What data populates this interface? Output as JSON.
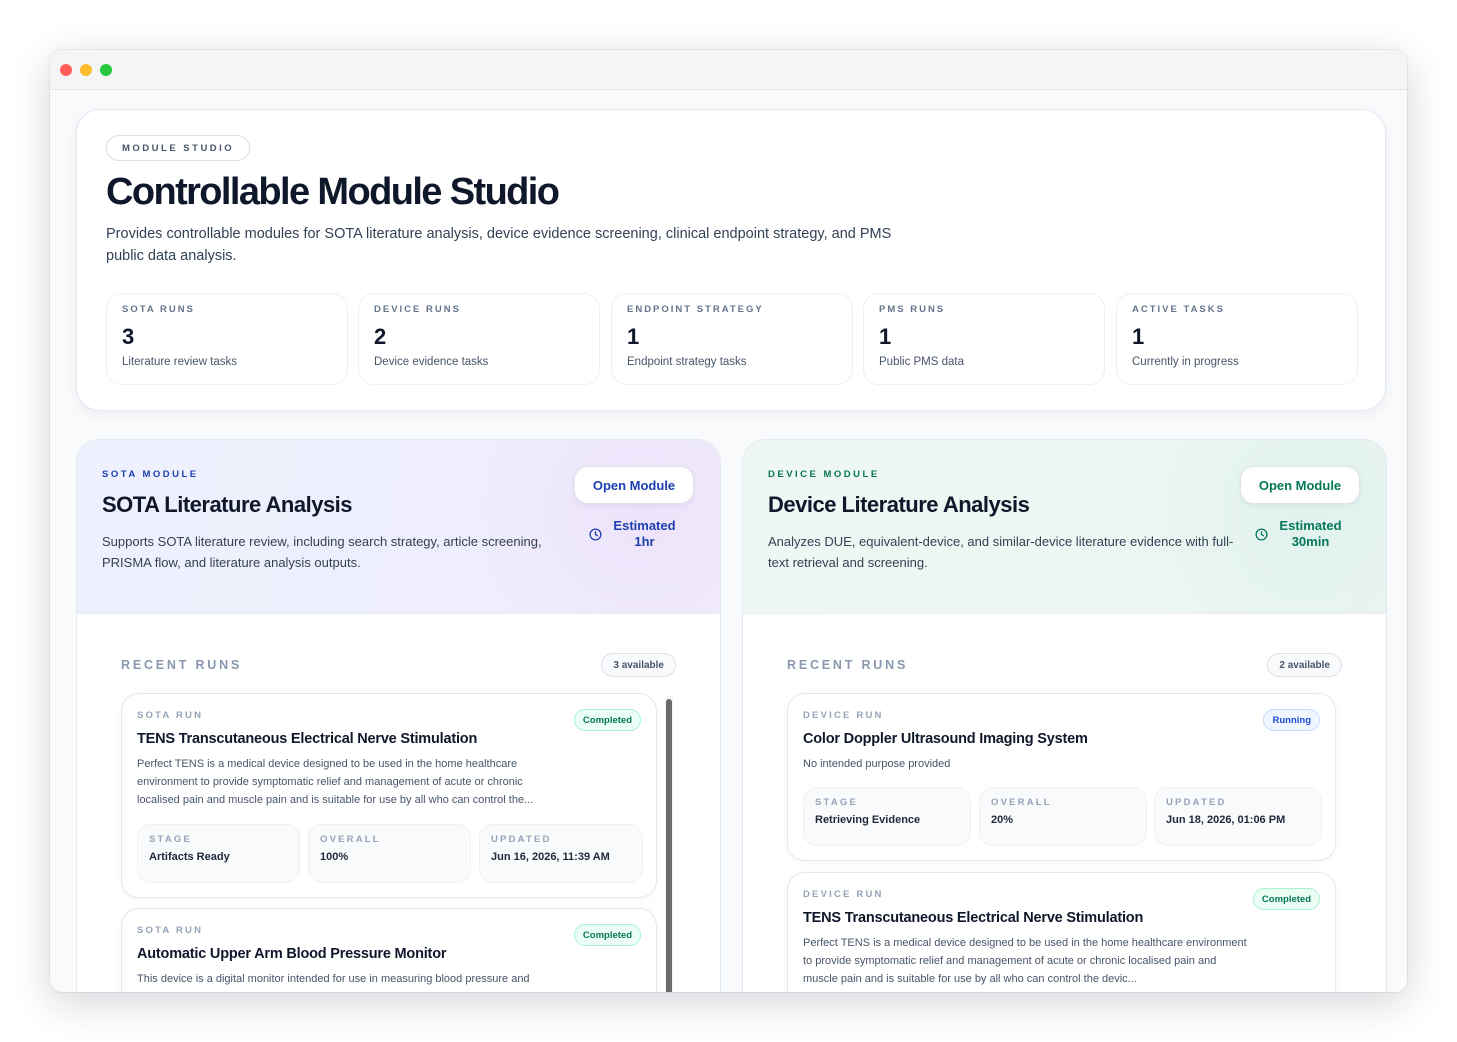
{
  "window": {
    "traffic_lights": [
      "#ff5f57",
      "#febc2e",
      "#28c840"
    ]
  },
  "hero": {
    "eyebrow": "MODULE STUDIO",
    "title": "Controllable Module Studio",
    "description": "Provides controllable modules for SOTA literature analysis, device evidence screening, clinical endpoint strategy, and PMS public data analysis.",
    "stats": [
      {
        "label": "SOTA RUNS",
        "value": "3",
        "sub": "Literature review tasks"
      },
      {
        "label": "DEVICE RUNS",
        "value": "2",
        "sub": "Device evidence tasks"
      },
      {
        "label": "ENDPOINT STRATEGY",
        "value": "1",
        "sub": "Endpoint strategy tasks"
      },
      {
        "label": "PMS RUNS",
        "value": "1",
        "sub": "Public PMS data"
      },
      {
        "label": "ACTIVE TASKS",
        "value": "1",
        "sub": "Currently in progress"
      }
    ]
  },
  "sota": {
    "accent": "#1e40af",
    "eyebrow": "SOTA MODULE",
    "title": "SOTA Literature Analysis",
    "description": "Supports SOTA literature review, including search strategy, article screening, PRISMA flow, and literature analysis outputs.",
    "open_label": "Open Module",
    "estimate_label": "Estimated",
    "estimate_value": "1hr",
    "recent_label": "RECENT RUNS",
    "available": "3 available",
    "runs": [
      {
        "eyebrow": "SOTA RUN",
        "title": "TENS Transcutaneous Electrical Nerve Stimulation",
        "status": "Completed",
        "description": "Perfect TENS is a medical device designed to be used in the home healthcare environment to provide symptomatic relief and management of acute or chronic localised pain and muscle pain and is suitable for use by all who can control the...",
        "stage_label": "STAGE",
        "stage": "Artifacts Ready",
        "overall_label": "OVERALL",
        "overall": "100%",
        "updated_label": "UPDATED",
        "updated": "Jun 16, 2026, 11:39 AM"
      },
      {
        "eyebrow": "SOTA RUN",
        "title": "Automatic Upper Arm Blood Pressure Monitor",
        "status": "Completed",
        "description": "This device is a digital monitor intended for use in measuring blood pressure and"
      }
    ]
  },
  "device": {
    "accent": "#047857",
    "eyebrow": "DEVICE MODULE",
    "title": "Device Literature Analysis",
    "description": "Analyzes DUE, equivalent-device, and similar-device literature evidence with full-text retrieval and screening.",
    "open_label": "Open Module",
    "estimate_label": "Estimated",
    "estimate_value": "30min",
    "recent_label": "RECENT RUNS",
    "available": "2 available",
    "runs": [
      {
        "eyebrow": "DEVICE RUN",
        "title": "Color Doppler Ultrasound Imaging System",
        "status": "Running",
        "description": "No intended purpose provided",
        "stage_label": "STAGE",
        "stage": "Retrieving Evidence",
        "overall_label": "OVERALL",
        "overall": "20%",
        "updated_label": "UPDATED",
        "updated": "Jun 18, 2026, 01:06 PM"
      },
      {
        "eyebrow": "DEVICE RUN",
        "title": "TENS Transcutaneous Electrical Nerve Stimulation",
        "status": "Completed",
        "description": "Perfect TENS is a medical device designed to be used in the home healthcare environment to provide symptomatic relief and management of acute or chronic localised pain and muscle pain and is suitable for use by all who can control the devic..."
      }
    ]
  }
}
